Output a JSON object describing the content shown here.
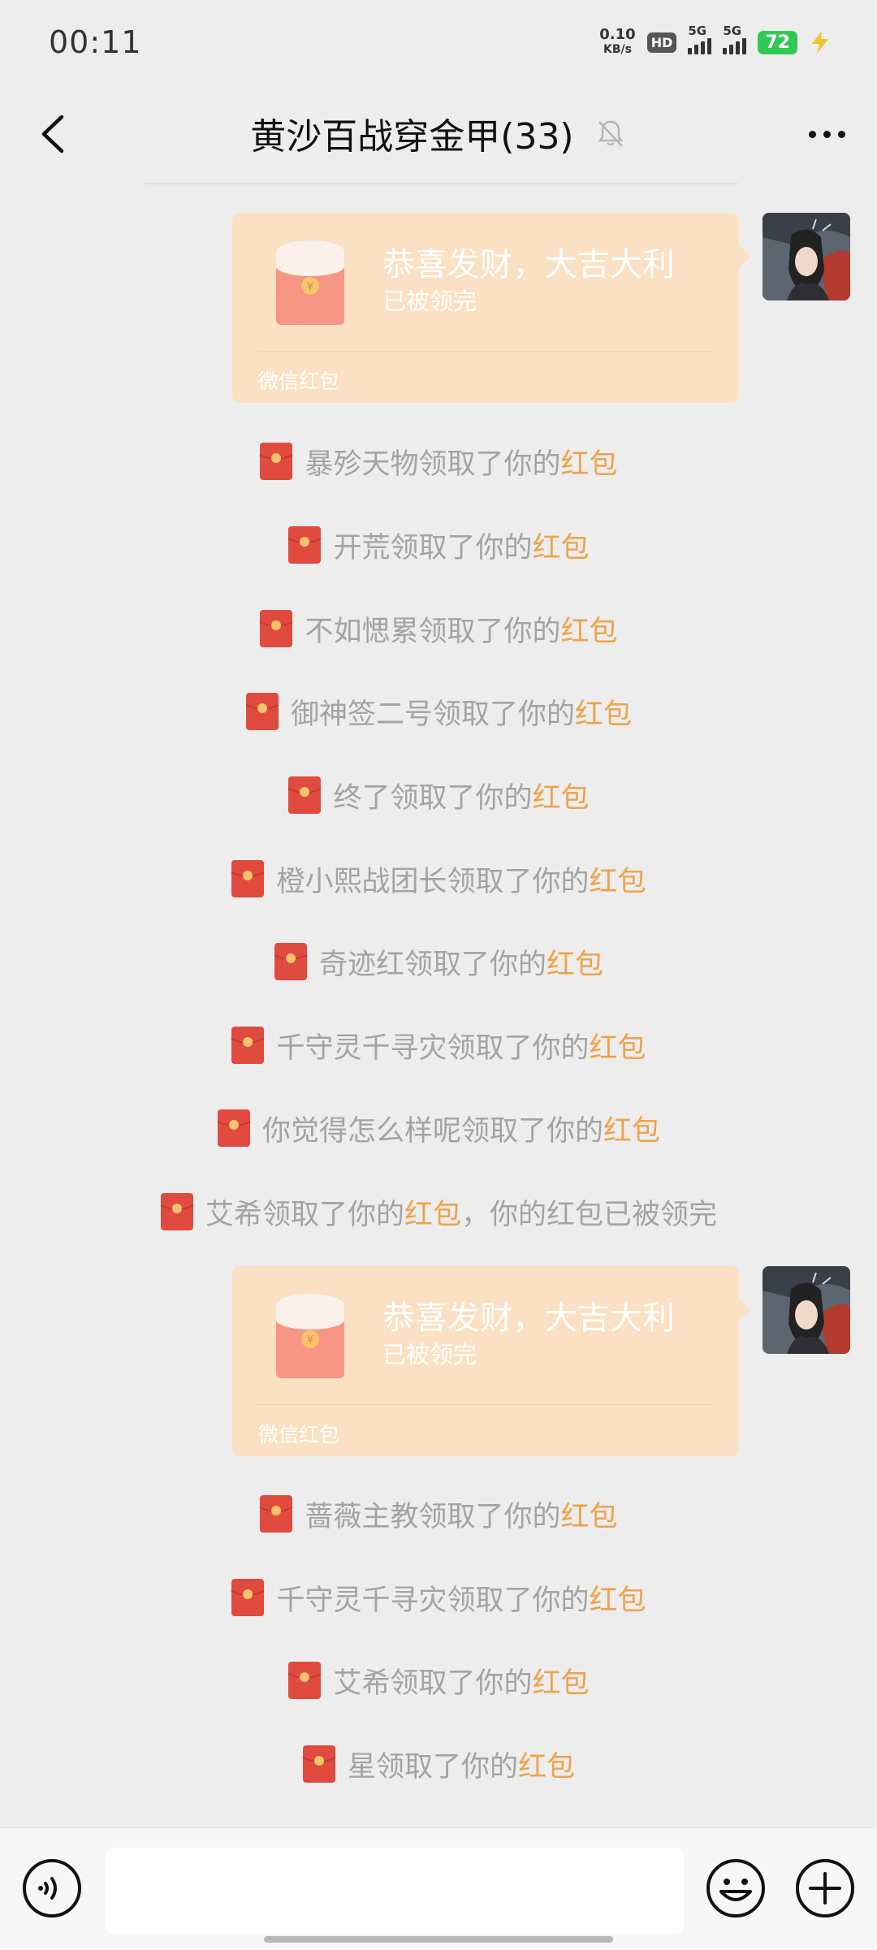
{
  "status_bar": {
    "time": "00:11",
    "net_speed": "0.10",
    "net_unit": "KB/s",
    "hd_label": "HD",
    "sim1_label": "5G",
    "sim2_label": "5G",
    "battery": "72",
    "battery_color": "#2fc853"
  },
  "header": {
    "title": "黄沙百战穿金甲(33)",
    "back_icon": "chevron-left-icon",
    "mute_icon": "bell-off-icon",
    "more_icon": "more-dots-icon"
  },
  "red_packets": [
    {
      "greeting": "恭喜发财，大吉大利",
      "status": "已被领完",
      "footer": "微信红包"
    },
    {
      "greeting": "恭喜发财，大吉大利",
      "status": "已被领完",
      "footer": "微信红包"
    }
  ],
  "notices": [
    {
      "name": "暴殄天物",
      "middle": "领取了你的",
      "link": "红包",
      "suffix": ""
    },
    {
      "name": "开荒",
      "middle": "领取了你的",
      "link": "红包",
      "suffix": ""
    },
    {
      "name": "不如愢累",
      "middle": "领取了你的",
      "link": "红包",
      "suffix": ""
    },
    {
      "name": "御神签二号",
      "middle": "领取了你的",
      "link": "红包",
      "suffix": ""
    },
    {
      "name": "终了",
      "middle": "领取了你的",
      "link": "红包",
      "suffix": ""
    },
    {
      "name": "橙小熙战团长",
      "middle": "领取了你的",
      "link": "红包",
      "suffix": ""
    },
    {
      "name": "奇迹红",
      "middle": "领取了你的",
      "link": "红包",
      "suffix": ""
    },
    {
      "name": "千守灵千寻灾",
      "middle": "领取了你的",
      "link": "红包",
      "suffix": ""
    },
    {
      "name": "你觉得怎么样呢",
      "middle": "领取了你的",
      "link": "红包",
      "suffix": ""
    },
    {
      "name": "艾希",
      "middle": "领取了你的",
      "link": "红包",
      "suffix": "，你的红包已被领完"
    },
    {
      "name": "蔷薇主教",
      "middle": "领取了你的",
      "link": "红包",
      "suffix": ""
    },
    {
      "name": "千守灵千寻灾",
      "middle": "领取了你的",
      "link": "红包",
      "suffix": ""
    },
    {
      "name": "艾希",
      "middle": "领取了你的",
      "link": "红包",
      "suffix": ""
    },
    {
      "name": "星",
      "middle": "领取了你的",
      "link": "红包",
      "suffix": ""
    }
  ],
  "colors": {
    "background": "#ededed",
    "red_packet": "#fbe0c3",
    "highlight": "#f0a24a",
    "notice_text": "#a3a3a3",
    "envelope_red": "#e04a3f"
  },
  "input_bar": {
    "voice_icon": "voice-icon",
    "emoji_icon": "emoji-icon",
    "plus_icon": "plus-icon",
    "input_value": ""
  }
}
